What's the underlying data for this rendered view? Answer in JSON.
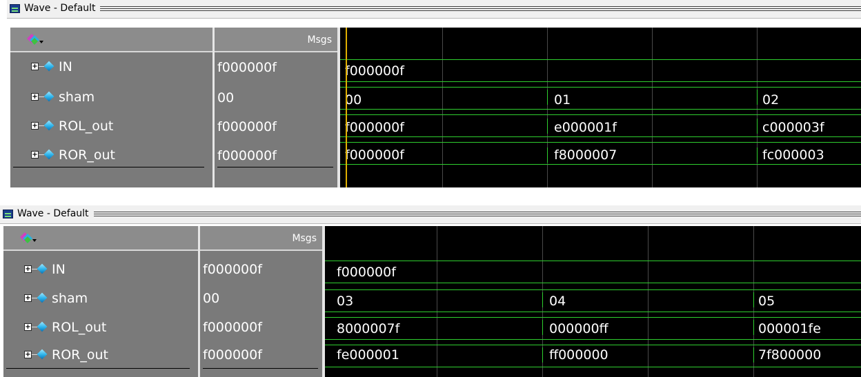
{
  "windows": [
    {
      "title": "Wave - Default",
      "column_header": {
        "msgs": "Msgs"
      },
      "signals": [
        {
          "name": "IN",
          "value": "f000000f",
          "wave": [
            "f000000f"
          ]
        },
        {
          "name": "sham",
          "value": "00",
          "wave": [
            "00",
            "01",
            "02"
          ]
        },
        {
          "name": "ROL_out",
          "value": "f000000f",
          "wave": [
            "f000000f",
            "e000001f",
            "c000003f"
          ]
        },
        {
          "name": "ROR_out",
          "value": "f000000f",
          "wave": [
            "f000000f",
            "f8000007",
            "fc000003"
          ]
        }
      ]
    },
    {
      "title": "Wave - Default",
      "column_header": {
        "msgs": "Msgs"
      },
      "signals": [
        {
          "name": "IN",
          "value": "f000000f",
          "wave": [
            "f000000f"
          ]
        },
        {
          "name": "sham",
          "value": "00",
          "wave": [
            "03",
            "04",
            "05"
          ]
        },
        {
          "name": "ROL_out",
          "value": "f000000f",
          "wave": [
            "8000007f",
            "000000ff",
            "000001fe"
          ]
        },
        {
          "name": "ROR_out",
          "value": "f000000f",
          "wave": [
            "fe000001",
            "ff000000",
            "7f800000"
          ]
        }
      ]
    }
  ],
  "icons": {
    "window": "waveform-window-icon",
    "toolbar": "wave-tool-dropdown-icon",
    "signal": "signal-diamond-icon",
    "expand": "expand-plus-icon"
  },
  "colors": {
    "trace": "#2fd02f",
    "cursor": "#e0b000",
    "pane": "#7a7a7a",
    "wave_bg": "#000000"
  }
}
